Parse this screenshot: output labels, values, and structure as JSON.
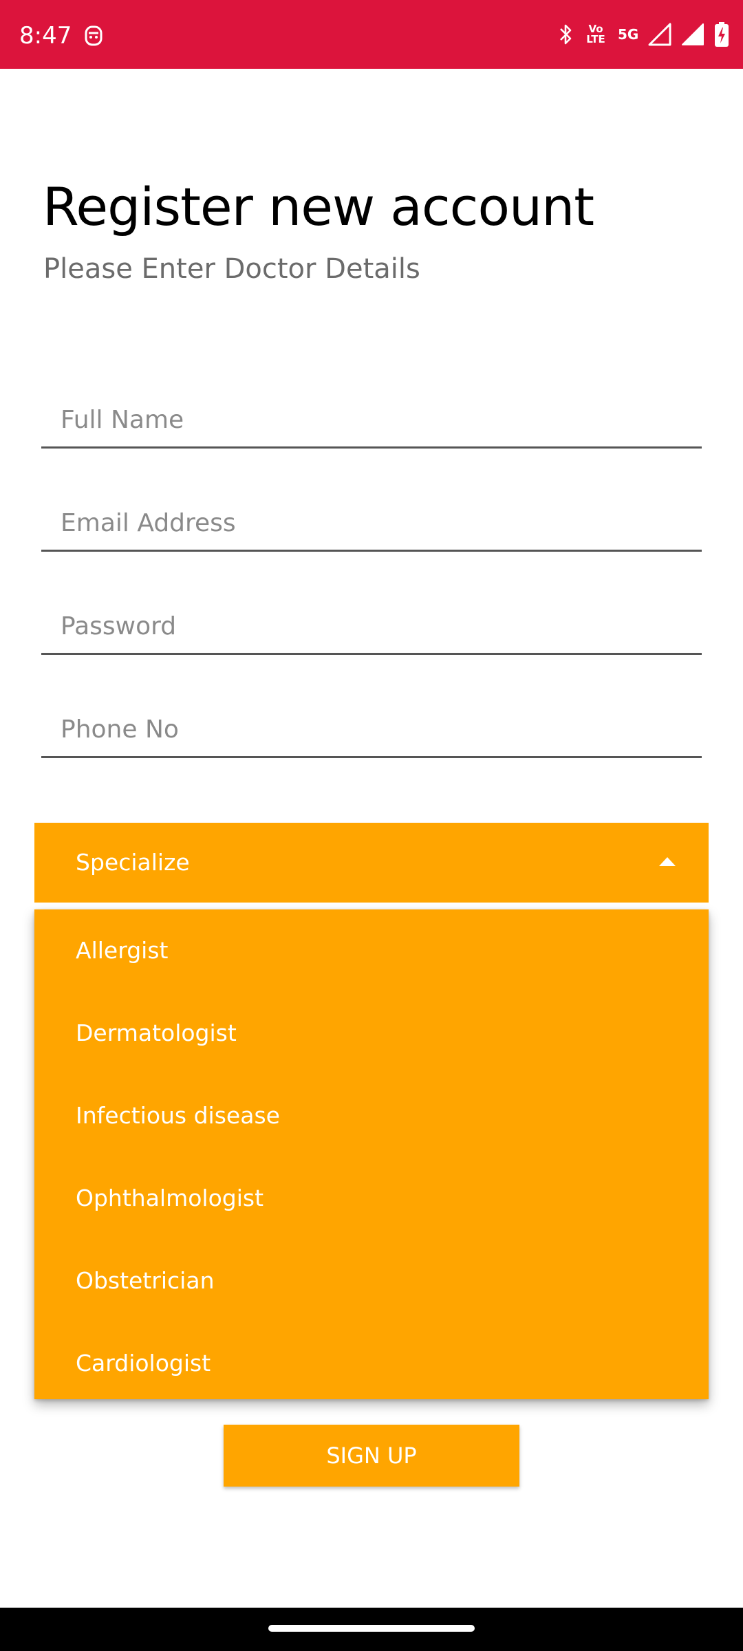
{
  "status_bar": {
    "time": "8:47",
    "volte_top": "Vo",
    "volte_bottom": "LTE",
    "network": "5G",
    "background_color": "#dc143c",
    "icons": [
      "app-notification-icon",
      "bluetooth-icon",
      "volte-icon",
      "signal-icon",
      "signal-icon",
      "battery-charging-icon"
    ]
  },
  "header": {
    "title": "Register new account",
    "subtitle": "Please Enter Doctor Details"
  },
  "form": {
    "full_name": {
      "placeholder": "Full Name",
      "value": ""
    },
    "email": {
      "placeholder": "Email Address",
      "value": ""
    },
    "password": {
      "placeholder": "Password",
      "value": ""
    },
    "phone": {
      "placeholder": "Phone No",
      "value": ""
    }
  },
  "specialize": {
    "label": "Specialize",
    "expanded": true,
    "options": [
      "Allergist",
      "Dermatologist",
      "Infectious disease",
      "Ophthalmologist",
      "Obstetrician",
      "Cardiologist"
    ]
  },
  "signup": {
    "label": "SIGN UP"
  },
  "colors": {
    "accent": "#ffa500",
    "status_bar": "#dc143c"
  }
}
